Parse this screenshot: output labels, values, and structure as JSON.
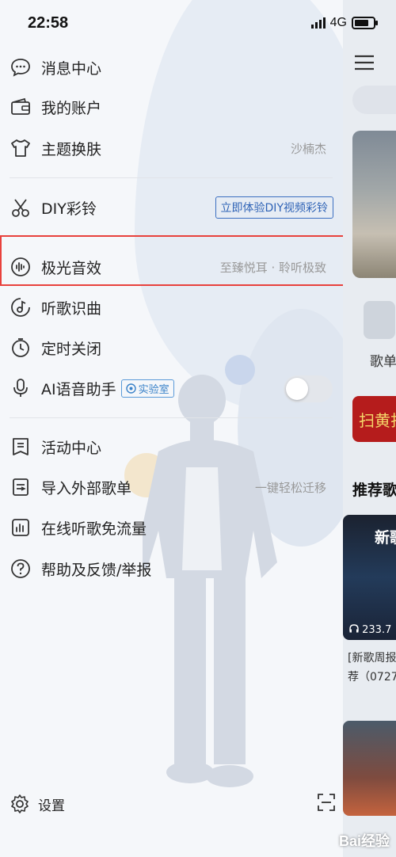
{
  "status_bar": {
    "time": "22:58",
    "network": "4G",
    "battery_level": 0.75
  },
  "menu": {
    "items": [
      {
        "label": "消息中心",
        "icon": "message-icon"
      },
      {
        "label": "我的账户",
        "icon": "wallet-icon"
      },
      {
        "label": "主题换肤",
        "icon": "tshirt-icon",
        "extra": "沙楠杰"
      },
      {
        "label": "DIY彩铃",
        "icon": "scissors-icon",
        "button": "立即体验DIY视频彩铃"
      },
      {
        "label": "极光音效",
        "icon": "sound-wave-icon",
        "extra": "至臻悦耳 · 聆听极致"
      },
      {
        "label": "听歌识曲",
        "icon": "music-recognize-icon"
      },
      {
        "label": "定时关闭",
        "icon": "timer-icon"
      },
      {
        "label": "AI语音助手",
        "icon": "microphone-icon",
        "tag": "实验室",
        "toggle_on": false
      },
      {
        "label": "活动中心",
        "icon": "activity-icon"
      },
      {
        "label": "导入外部歌单",
        "icon": "import-playlist-icon",
        "extra": "一键轻松迁移"
      },
      {
        "label": "在线听歌免流量",
        "icon": "data-free-icon"
      },
      {
        "label": "帮助及反馈/举报",
        "icon": "help-icon"
      }
    ]
  },
  "bottom": {
    "settings_label": "设置"
  },
  "main_view": {
    "playlist_label": "歌单",
    "banner_text": "扫黄打",
    "section_title": "推荐歌",
    "card_title": "新歌",
    "card_count": "233.7",
    "card_caption_1": "[新歌周报",
    "card_caption_2": "荐（0727"
  },
  "watermark": "Bai经验"
}
